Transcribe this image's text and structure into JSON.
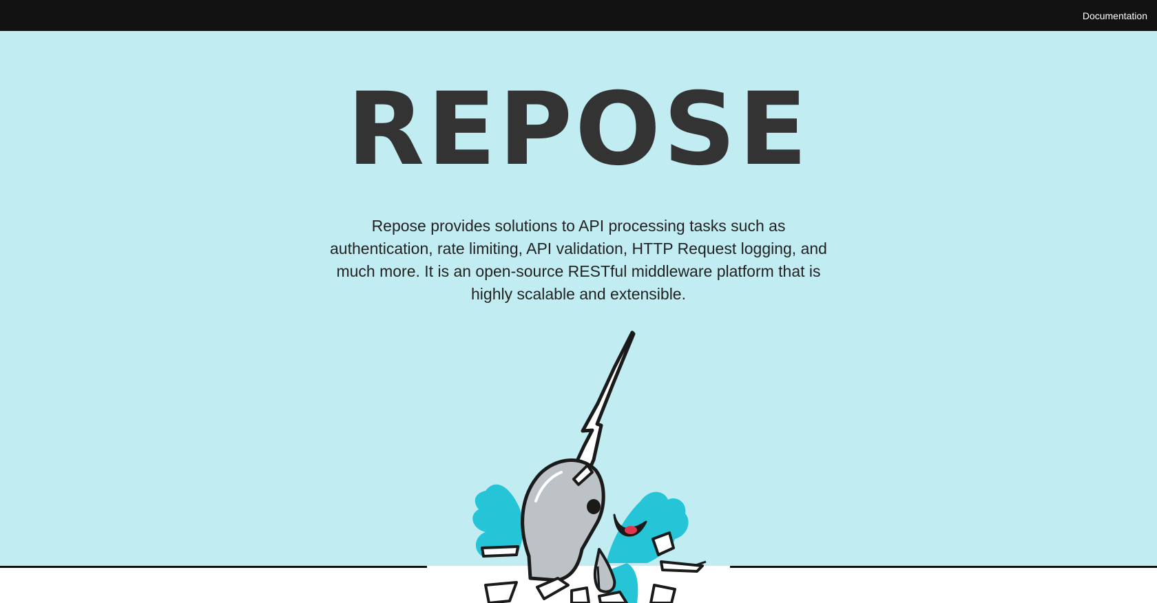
{
  "nav": {
    "documentation_label": "Documentation"
  },
  "hero": {
    "title": "REPOSE",
    "tagline": "Repose provides solutions to API processing tasks such as authentication, rate limiting, API validation, HTTP Request logging, and much more. It is an open-source RESTful middleware platform that is highly scalable and extensible.",
    "mascot_icon": "narwhal-icon"
  },
  "colors": {
    "topbar": "#121212",
    "hero_background": "#c1edf2",
    "title_text": "#333333",
    "splash": "#25c4d6",
    "narwhal_body": "#bcc2c5",
    "mouth": "#e2344f"
  }
}
